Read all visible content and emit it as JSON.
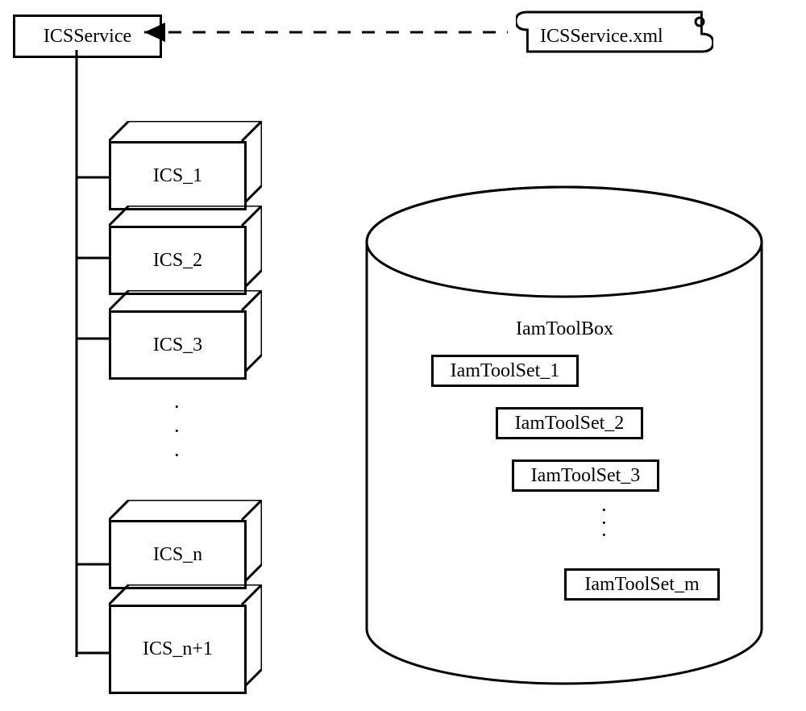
{
  "root_label": "ICSService",
  "xml_label": "ICSService.xml",
  "cubes": [
    "ICS_1",
    "ICS_2",
    "ICS_3",
    "ICS_n",
    "ICS_n+1"
  ],
  "cylinder_title": "IamToolBox",
  "toolsets": [
    "IamToolSet_1",
    "IamToolSet_2",
    "IamToolSet_3",
    "IamToolSet_m"
  ]
}
